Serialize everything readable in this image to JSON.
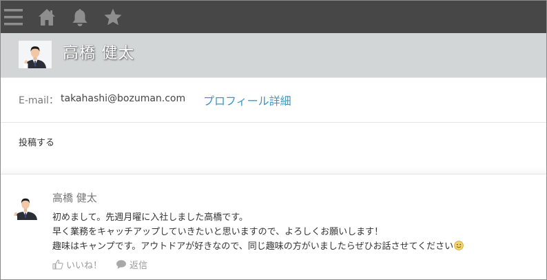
{
  "colors": {
    "topbar": "#474747",
    "topbar_icon": "#8e8e8e",
    "header_band": "#d3d6d7",
    "link": "#3a97c9"
  },
  "topbar": {
    "icons": [
      "menu-icon",
      "home-icon",
      "bell-icon",
      "star-icon"
    ]
  },
  "profile": {
    "name": "高橋 健太",
    "email_label": "E-mail：",
    "email": "takahashi@bozuman.com",
    "detail_link": "プロフィール詳細"
  },
  "composer": {
    "placeholder": "投稿する"
  },
  "post": {
    "author": "高橋 健太",
    "lines": [
      "初めまして。先週月曜に入社しました高橋です。",
      "早く業務をキャッチアップしていきたいと思いますので、よろしくお願いします！",
      "趣味はキャンプです。アウトドアが好きなので、同じ趣味の方がいましたらぜひお話させてください"
    ],
    "emoji": "smile-emoji",
    "like_label": "いいね！",
    "reply_label": "返信"
  }
}
